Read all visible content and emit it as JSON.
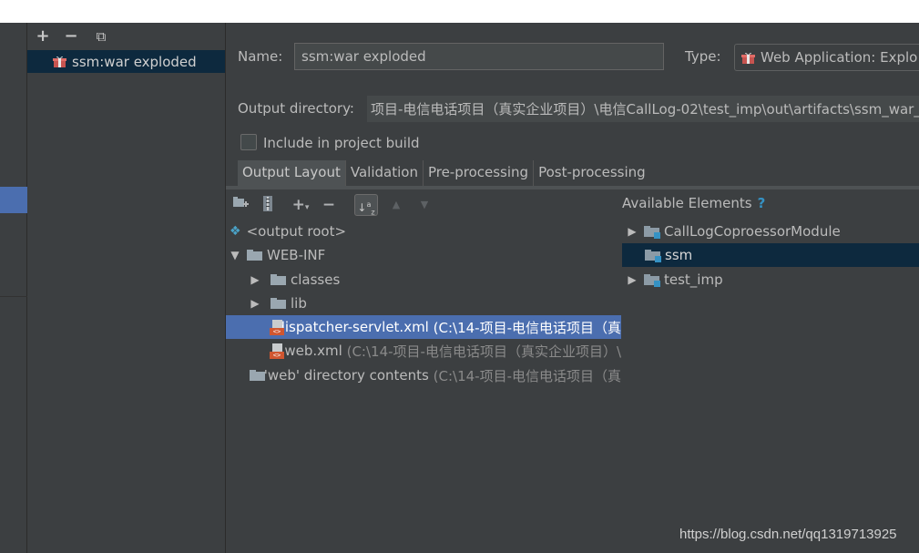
{
  "left_toolbar": {
    "add": "+",
    "remove": "−",
    "copy": "⧉"
  },
  "artifacts": [
    {
      "label": "ssm:war exploded",
      "icon": "war-artifact-icon"
    }
  ],
  "form": {
    "name_label": "Name:",
    "name_value": "ssm:war exploded",
    "type_label": "Type:",
    "type_value": "Web Application: Explo",
    "output_dir_label": "Output directory:",
    "output_dir_value": "项目-电信电话项目（真实企业项目）\\电信CallLog-02\\test_imp\\out\\artifacts\\ssm_war_e",
    "include_build_label": "Include in project build",
    "include_build_checked": false
  },
  "tabs": [
    {
      "label": "Output Layout",
      "active": true
    },
    {
      "label": "Validation",
      "active": false
    },
    {
      "label": "Pre-processing",
      "active": false
    },
    {
      "label": "Post-processing",
      "active": false
    }
  ],
  "layout_tree": {
    "root": "<output root>",
    "web_inf": "WEB-INF",
    "classes": "classes",
    "lib": "lib",
    "dispatcher": {
      "name": "dispatcher-servlet.xml",
      "path": "(C:\\14-项目-电信电话项目（真"
    },
    "webxml": {
      "name": "web.xml",
      "path": "(C:\\14-项目-电信电话项目（真实企业项目）\\"
    },
    "web_dir": {
      "name": "'web' directory contents",
      "path": "(C:\\14-项目-电信电话项目（真"
    }
  },
  "available": {
    "title": "Available Elements",
    "help": "?",
    "items": [
      "CallLogCoproessorModule",
      "ssm",
      "test_imp"
    ]
  },
  "watermark": "https://blog.csdn.net/qq1319713925",
  "colors": {
    "background": "#3c3f41",
    "selection": "#4b6eaf",
    "inactive_selection": "#0d293e",
    "accent": "#3592c4"
  }
}
